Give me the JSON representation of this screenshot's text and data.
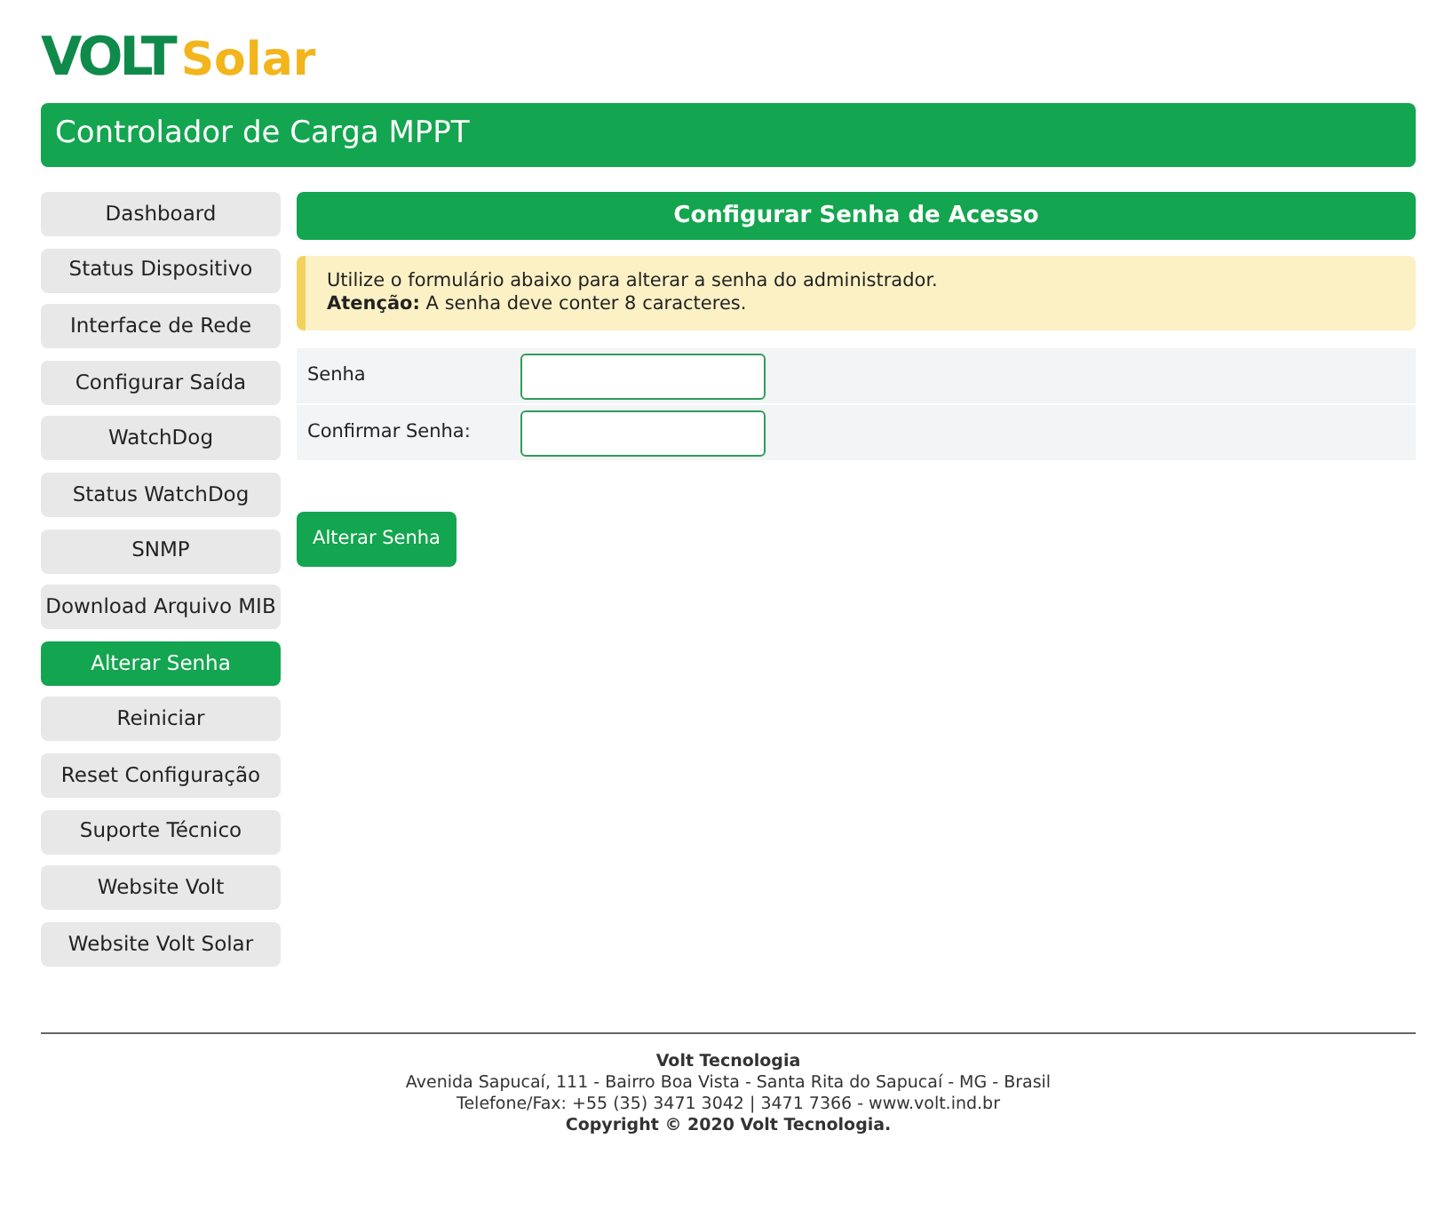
{
  "logo": {
    "brand": "VOLT",
    "product": "Solar"
  },
  "header": {
    "title": "Controlador de Carga MPPT"
  },
  "sidebar": {
    "items": [
      {
        "label": "Dashboard",
        "selected": false
      },
      {
        "label": "Status Dispositivo",
        "selected": false
      },
      {
        "label": "Interface de Rede",
        "selected": false
      },
      {
        "label": "Configurar Saída",
        "selected": false
      },
      {
        "label": "WatchDog",
        "selected": false
      },
      {
        "label": "Status WatchDog",
        "selected": false
      },
      {
        "label": "SNMP",
        "selected": false
      },
      {
        "label": "Download Arquivo MIB",
        "selected": false
      },
      {
        "label": "Alterar Senha",
        "selected": true
      },
      {
        "label": "Reiniciar",
        "selected": false
      },
      {
        "label": "Reset Configuração",
        "selected": false
      },
      {
        "label": "Suporte Técnico",
        "selected": false
      },
      {
        "label": "Website Volt",
        "selected": false
      },
      {
        "label": "Website Volt Solar",
        "selected": false
      }
    ]
  },
  "panel": {
    "title": "Configurar Senha de Acesso",
    "alert": {
      "lines": [
        "Utilize o formulário abaixo para alterar a senha do administrador.",
        "**Atenção:** A senha deve conter 8 caracteres."
      ]
    },
    "fields": [
      {
        "label": "Senha"
      },
      {
        "label": "Confirmar Senha:"
      }
    ],
    "submit": "Alterar Senha"
  },
  "footer": {
    "lines": [
      {
        "text": "Volt Tecnologia",
        "bold": true
      },
      {
        "text": "Avenida Sapucaí, 111 - Bairro Boa Vista - Santa Rita do Sapucaí - MG - Brasil",
        "bold": false
      },
      {
        "text": "Telefone/Fax: +55 (35) 3471 3042 | 3471 7366 - www.volt.ind.br",
        "bold": false
      },
      {
        "text": "Copyright © 2020 Volt Tecnologia.",
        "bold": true
      }
    ]
  }
}
